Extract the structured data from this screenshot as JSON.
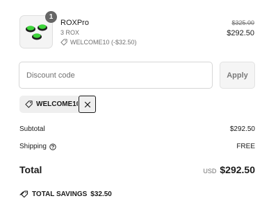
{
  "product": {
    "name": "ROXPro",
    "variant": "3 ROX",
    "quantity": "1",
    "discount_line": "WELCOME10 (-$32.50)",
    "price_original": "$325.00",
    "price_now": "$292.50"
  },
  "discount": {
    "placeholder": "Discount code",
    "apply_label": "Apply",
    "applied_code": "WELCOME10"
  },
  "summary": {
    "subtotal_label": "Subtotal",
    "subtotal_value": "$292.50",
    "shipping_label": "Shipping",
    "shipping_value": "FREE",
    "total_label": "Total",
    "currency": "USD",
    "total_value": "$292.50",
    "savings_label": "TOTAL SAVINGS",
    "savings_value": "$32.50"
  },
  "icons": {
    "tag": "tag-icon",
    "remove": "close-icon",
    "help": "help-circle-icon",
    "savings": "tags-icon"
  }
}
